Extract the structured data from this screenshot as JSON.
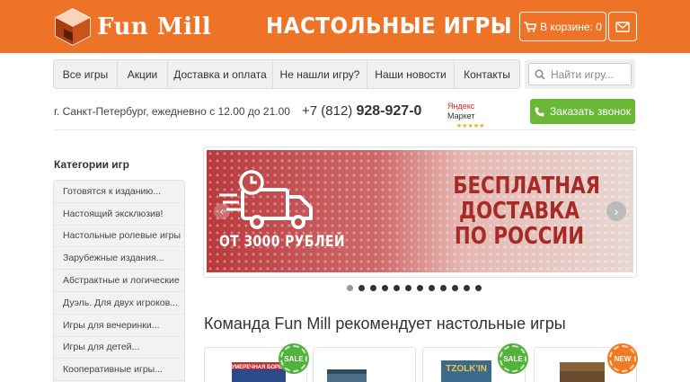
{
  "header": {
    "logo_text": "Fun Mill",
    "title": "НАСТОЛЬНЫЕ ИГРЫ",
    "cart_label": "В корзине: 0"
  },
  "nav": {
    "items": [
      {
        "label": "Все игры"
      },
      {
        "label": "Акции"
      },
      {
        "label": "Доставка и оплата"
      },
      {
        "label": "Не нашли игру?"
      },
      {
        "label": "Наши новости"
      },
      {
        "label": "Контакты"
      }
    ],
    "search_placeholder": "Найти игру..."
  },
  "info": {
    "city_hours": "г. Санкт-Петербург, ежедневно с 12.00 до 21.00",
    "phone_prefix": "+7 (812)",
    "phone_number": "928-927-0",
    "market_label_1": "Яндекс",
    "market_label_2": "Маркет",
    "market_stars": "★★★★★",
    "callback_label": "Заказать звонок"
  },
  "sidebar": {
    "title": "Категории игр",
    "items": [
      {
        "label": "Готовятся к изданию..."
      },
      {
        "label": "Настоящий эксклюзив!"
      },
      {
        "label": "Настольные ролевые игры"
      },
      {
        "label": "Зарубежные издания..."
      },
      {
        "label": "Абстрактные и логические"
      },
      {
        "label": "Дуэль. Для двух игроков..."
      },
      {
        "label": "Игры для вечеринки..."
      },
      {
        "label": "Игры для детей..."
      },
      {
        "label": "Кооперативные игры..."
      }
    ]
  },
  "banner": {
    "from_text": "ОТ 3000 РУБЛЕЙ",
    "promo_line_1": "БЕСПЛАТНАЯ",
    "promo_line_2": "ДОСТАВКА",
    "promo_line_3": "ПО РОССИИ",
    "slide_count": 12,
    "active_slide": 1
  },
  "recommend": {
    "title": "Команда Fun Mill рекомендует настольные игры",
    "products": [
      {
        "badge": "SALE",
        "box_text": "СУМЕРЕЧНАЯ БОРЬБА"
      },
      {
        "badge": "",
        "box_text": ""
      },
      {
        "badge": "SALE",
        "box_text": "TZOLK'IN"
      },
      {
        "badge": "NEW",
        "box_text": ""
      }
    ]
  },
  "colors": {
    "brand_orange": "#ef7326",
    "callback_green": "#69b837",
    "sale_green": "#53b13c",
    "new_orange": "#f07a22"
  },
  "icons": {
    "cart": "cart-icon",
    "mail": "envelope-icon",
    "search": "search-icon",
    "phone": "phone-icon"
  }
}
